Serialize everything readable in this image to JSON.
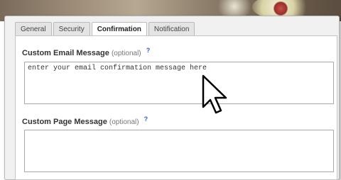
{
  "tabs": [
    {
      "label": "General"
    },
    {
      "label": "Security"
    },
    {
      "label": "Confirmation"
    },
    {
      "label": "Notification"
    }
  ],
  "active_tab": "Confirmation",
  "email_message": {
    "label": "Custom Email Message",
    "optional": "(optional)",
    "help": "?",
    "placeholder": "enter your email confirmation message here",
    "value": ""
  },
  "page_message": {
    "label": "Custom Page Message",
    "optional": "(optional)",
    "help": "?",
    "placeholder": "",
    "value": ""
  },
  "icons": {
    "cursor": "pointer-arrow-icon"
  }
}
